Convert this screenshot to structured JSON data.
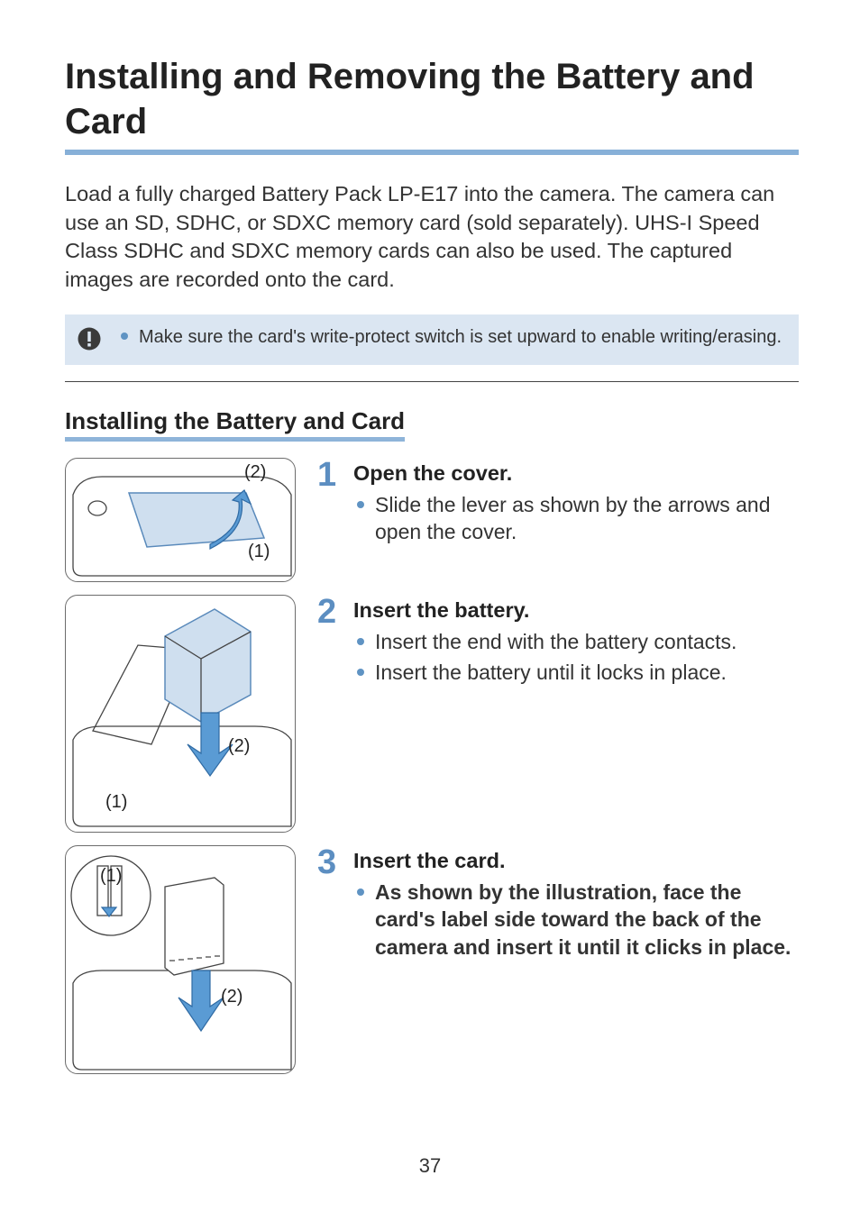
{
  "title": "Installing and Removing the Battery and Card",
  "intro": "Load a fully charged Battery Pack LP-E17 into the camera. The camera can use an SD, SDHC, or SDXC memory card (sold separately). UHS-I Speed Class SDHC and SDXC memory cards can also be used. The captured images are recorded onto the card.",
  "callout": "Make sure the card's write-protect switch is set upward to enable writing/erasing.",
  "section_heading": "Installing the Battery and Card",
  "steps": [
    {
      "num": "1",
      "title": "Open the cover.",
      "bullets": [
        "Slide the lever as shown by the arrows and open the cover."
      ],
      "bold": [
        false
      ],
      "illus_labels": [
        "(2)",
        "(1)"
      ]
    },
    {
      "num": "2",
      "title": "Insert the battery.",
      "bullets": [
        "Insert the end with the battery contacts.",
        "Insert the battery until it locks in place."
      ],
      "bold": [
        false,
        false
      ],
      "illus_labels": [
        "(2)",
        "(1)"
      ]
    },
    {
      "num": "3",
      "title": "Insert the card.",
      "bullets": [
        "As shown by the illustration, face the card's label side toward the back of the camera and insert it until it clicks in place."
      ],
      "bold": [
        true
      ],
      "illus_labels": [
        "(1)",
        "(2)"
      ]
    }
  ],
  "page_number": "37"
}
